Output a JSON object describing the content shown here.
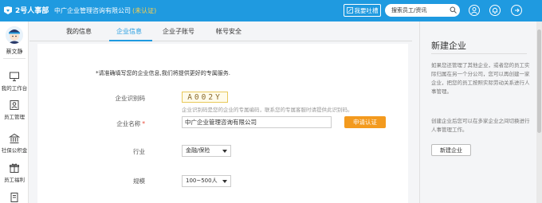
{
  "app": {
    "name": "2号人事部"
  },
  "header": {
    "company": "中广企业管理咨询有限公司",
    "status": "(未认证)",
    "feedback_label": "我要吐槽",
    "search_placeholder": "搜索员工/资讯"
  },
  "user": {
    "name": "蔡文静"
  },
  "sidebar": {
    "items": [
      {
        "label": "我的工作台",
        "icon": "monitor-icon"
      },
      {
        "label": "员工管理",
        "icon": "users-icon"
      },
      {
        "label": "社保公积金",
        "icon": "bank-icon"
      },
      {
        "label": "员工福利",
        "icon": "gift-icon"
      }
    ]
  },
  "tabs": [
    {
      "label": "我的信息"
    },
    {
      "label": "企业信息",
      "active": true
    },
    {
      "label": "企业子账号"
    },
    {
      "label": "帐号安全"
    }
  ],
  "form": {
    "notice": "*请准确填写您的企业信息,我们将提供更好的专属服务.",
    "code_label": "企业识别码",
    "code_value": "A002Y",
    "code_hint": "企业识别码是您的企业的专属编码，联系您的专属客服时请提供此识别码。",
    "name_label": "企业名称",
    "required_mark": "*",
    "name_value": "中广企业管理咨询有限公司",
    "apply_label": "申请认证",
    "industry_label": "行业",
    "industry_value": "金融/保险",
    "scale_label": "规模",
    "scale_value": "100~500人"
  },
  "right_panel": {
    "title": "新建企业",
    "paragraph1": "如果您还管理了其他企业，或者您的员工实际归属在另一个分公司，您可以再创建一家企业，把您的员工按照实际劳动关系进行人事管理。",
    "paragraph2": "创建企业后您可以在多家企业之间切换进行人事管理工作。",
    "button_label": "新建企业"
  },
  "colors": {
    "primary": "#1f9ae0",
    "accent": "#f39a1e",
    "status": "#ffd24a"
  }
}
